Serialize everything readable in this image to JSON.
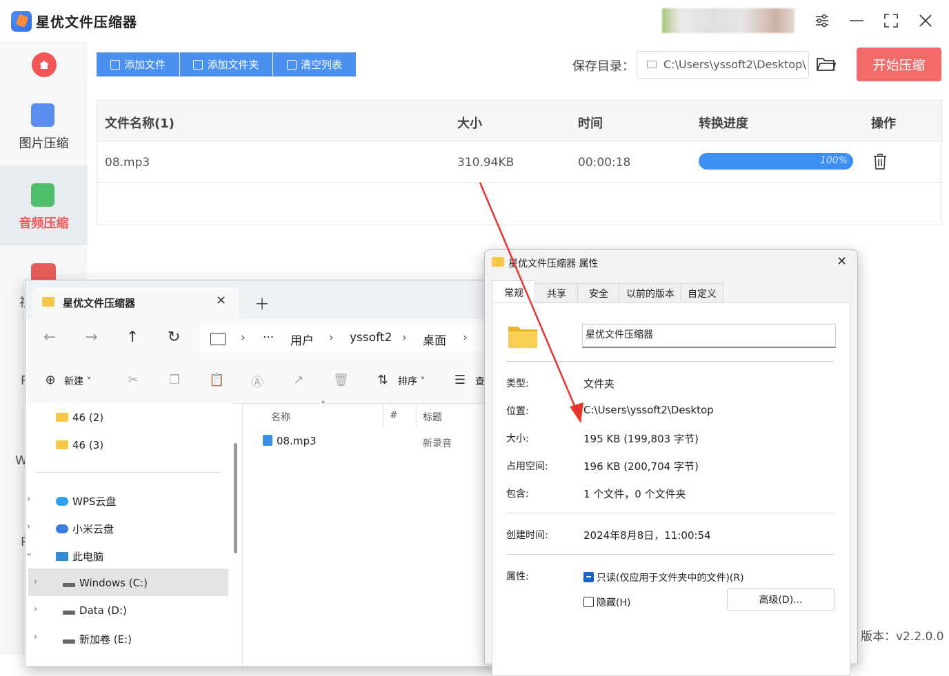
{
  "app": {
    "title": "星优文件压缩器",
    "version": "版本：v2.2.0.0"
  },
  "sidebar": {
    "items": [
      {
        "label": "图片压缩",
        "active": false
      },
      {
        "label": "音频压缩",
        "active": true
      },
      {
        "label": "视",
        "active": false
      }
    ],
    "peek": [
      "P",
      "W",
      "P"
    ]
  },
  "toolbar": {
    "add_file": "添加文件",
    "add_folder": "添加文件夹",
    "clear_list": "清空列表",
    "save_label": "保存目录：",
    "save_path": "C:\\Users\\yssoft2\\Desktop\\",
    "start": "开始压缩"
  },
  "table": {
    "headers": [
      "文件名称(1)",
      "大小",
      "时间",
      "转换进度",
      "操作"
    ],
    "rows": [
      {
        "name": "08.mp3",
        "size": "310.94KB",
        "time": "00:00:18",
        "progress_text": "100%",
        "progress": 1.0
      }
    ]
  },
  "explorer": {
    "tab_title": "星优文件压缩器",
    "breadcrumb": [
      "···",
      "用户",
      "yssoft2",
      "桌面"
    ],
    "commands": {
      "new": "新建",
      "sort": "排序",
      "view": "查"
    },
    "tree": [
      {
        "label": "46 (2)"
      },
      {
        "label": "46 (3)"
      },
      {
        "label": "WPS云盘"
      },
      {
        "label": "小米云盘"
      },
      {
        "label": "此电脑"
      },
      {
        "label": "Windows (C:)"
      },
      {
        "label": "Data (D:)"
      },
      {
        "label": "新加卷 (E:)"
      }
    ],
    "columns": [
      "名称",
      "#",
      "标题"
    ],
    "files": [
      {
        "name": "08.mp3",
        "title": "新录音"
      }
    ]
  },
  "properties": {
    "title": "星优文件压缩器 属性",
    "tabs": [
      "常规",
      "共享",
      "安全",
      "以前的版本",
      "自定义"
    ],
    "name": "星优文件压缩器",
    "type_label": "类型:",
    "type_value": "文件夹",
    "location_label": "位置:",
    "location_value": "C:\\Users\\yssoft2\\Desktop",
    "size_label": "大小:",
    "size_value": "195 KB (199,803 字节)",
    "disk_label": "占用空间:",
    "disk_value": "196 KB (200,704 字节)",
    "contains_label": "包含:",
    "contains_value": "1 个文件，0 个文件夹",
    "created_label": "创建时间:",
    "created_value": "2024年8月8日，11:00:54",
    "attr_label": "属性:",
    "readonly": "只读(仅应用于文件夹中的文件)(R)",
    "hidden": "隐藏(H)",
    "advanced": "高级(D)..."
  },
  "colors": {
    "accent": "#4a90f0",
    "start": "#f26a6a",
    "arrow": "#e8352b"
  }
}
